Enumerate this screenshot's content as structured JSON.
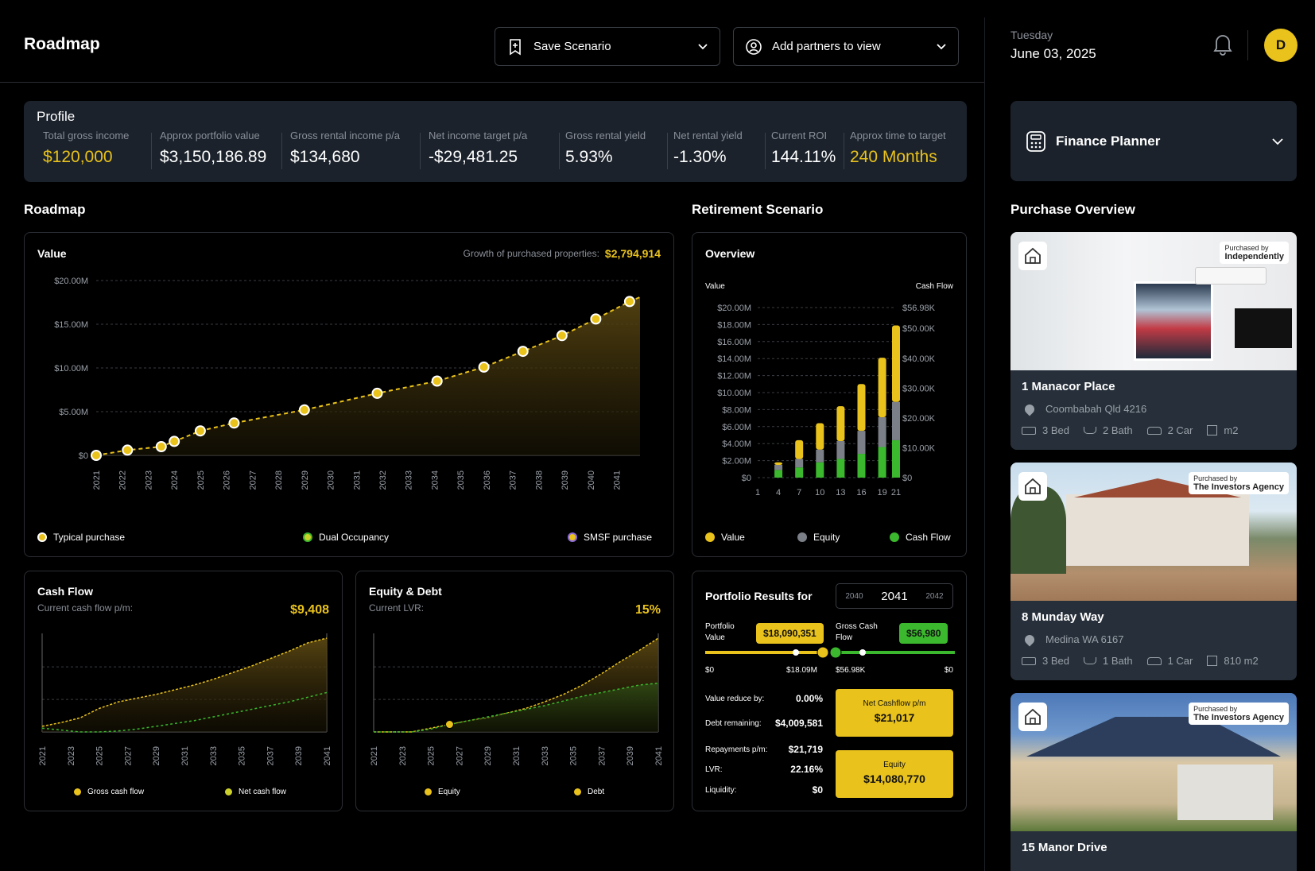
{
  "header": {
    "title": "Roadmap",
    "save_scenario": "Save Scenario",
    "add_partners": "Add partners to view",
    "day": "Tuesday",
    "date": "June 03, 2025",
    "avatar_initial": "D"
  },
  "profile": {
    "title": "Profile",
    "stats": [
      {
        "label": "Total gross income",
        "value": "$120,000"
      },
      {
        "label": "Approx portfolio value",
        "value": "$3,150,186.89"
      },
      {
        "label": "Gross rental income p/a",
        "value": "$134,680"
      },
      {
        "label": "Net income target p/a",
        "value": "-$29,481.25"
      },
      {
        "label": "Gross rental yield",
        "value": "5.93%"
      },
      {
        "label": "Net rental yield",
        "value": "-1.30%"
      },
      {
        "label": "Current ROI",
        "value": "144.11%"
      },
      {
        "label": "Approx time to target",
        "value": "240 Months"
      }
    ]
  },
  "sections": {
    "roadmap": "Roadmap",
    "retirement": "Retirement Scenario",
    "purchase_overview": "Purchase Overview"
  },
  "value_card": {
    "title": "Value",
    "growth_label": "Growth of purchased properties:",
    "growth_value": "$2,794,914",
    "legend": [
      "Typical purchase",
      "Dual Occupancy",
      "SMSF purchase"
    ]
  },
  "overview_card": {
    "title": "Overview",
    "left_axis_label": "Value",
    "right_axis_label": "Cash Flow",
    "legend": [
      "Value",
      "Equity",
      "Cash Flow"
    ]
  },
  "cashflow_card": {
    "title": "Cash Flow",
    "subtitle": "Current cash flow p/m:",
    "value": "$9,408",
    "legend": [
      "Gross cash flow",
      "Net cash flow"
    ]
  },
  "equity_card": {
    "title": "Equity & Debt",
    "subtitle": "Current LVR:",
    "value": "15%",
    "legend": [
      "Equity",
      "Debt"
    ]
  },
  "portfolio": {
    "title": "Portfolio Results for",
    "year_prev": "2040",
    "year_current": "2041",
    "year_next": "2042",
    "portfolio_value_label": "Portfolio Value",
    "portfolio_value": "$18,090,351",
    "gross_cash_label": "Gross Cash Flow",
    "gross_cash": "$56,980",
    "slider_left_min": "$0",
    "slider_left_mark": "$18.09M",
    "slider_right_mark": "$56.98K",
    "slider_right_min": "$0",
    "value_reduce_label": "Value reduce by:",
    "value_reduce": "0.00%",
    "debt_label": "Debt remaining:",
    "debt": "$4,009,581",
    "repay_label": "Repayments p/m:",
    "repay": "$21,719",
    "lvr_label": "LVR:",
    "lvr": "22.16%",
    "liquidity_label": "Liquidity:",
    "liquidity": "$0",
    "net_cashflow_label": "Net Cashflow p/m",
    "net_cashflow": "$21,017",
    "equity_label": "Equity",
    "equity": "$14,080,770"
  },
  "finance_planner": {
    "label": "Finance Planner"
  },
  "properties": [
    {
      "name": "1 Manacor Place",
      "address": "Coombabah Qld 4216",
      "bed": "3 Bed",
      "bath": "2 Bath",
      "car": "2 Car",
      "area": "m2",
      "purchased_by_label": "Purchased by",
      "purchased_by": "Independently"
    },
    {
      "name": "8 Munday Way",
      "address": "Medina WA 6167",
      "bed": "3 Bed",
      "bath": "1 Bath",
      "car": "1 Car",
      "area": "810 m2",
      "purchased_by_label": "Purchased by",
      "purchased_by": "The Investors Agency"
    },
    {
      "name": "15 Manor Drive",
      "address": "",
      "purchased_by_label": "Purchased by",
      "purchased_by": "The Investors Agency"
    }
  ],
  "colors": {
    "accent": "#e9c21c",
    "green": "#3bb82d",
    "gray": "#7b8088",
    "navy": "#1b222b"
  },
  "chart_data": [
    {
      "type": "line",
      "title": "Value",
      "x": [
        "2021",
        "2022",
        "2023",
        "2024",
        "2025",
        "2026",
        "2027",
        "2028",
        "2029",
        "2030",
        "2031",
        "2032",
        "2033",
        "2034",
        "2035",
        "2036",
        "2037",
        "2038",
        "2039",
        "2040",
        "2041"
      ],
      "yticks": [
        "$0",
        "$5.00M",
        "$10.00M",
        "$15.00M",
        "$20.00M"
      ],
      "ylim": [
        0,
        20
      ],
      "points": [
        [
          2021.0,
          0.0
        ],
        [
          2022.2,
          0.6
        ],
        [
          2023.5,
          1.0
        ],
        [
          2024.0,
          1.6
        ],
        [
          2025.0,
          2.8
        ],
        [
          2026.3,
          3.7
        ],
        [
          2029.0,
          5.2
        ],
        [
          2031.8,
          7.1
        ],
        [
          2034.1,
          8.5
        ],
        [
          2035.9,
          10.1
        ],
        [
          2037.4,
          11.9
        ],
        [
          2038.9,
          13.7
        ],
        [
          2040.2,
          15.6
        ],
        [
          2041.5,
          17.6
        ],
        [
          2041.9,
          18.1
        ]
      ],
      "markers": [
        [
          2021.0,
          0.0
        ],
        [
          2022.2,
          0.6
        ],
        [
          2023.5,
          1.0
        ],
        [
          2024.0,
          1.6
        ],
        [
          2025.0,
          2.8
        ],
        [
          2026.3,
          3.7
        ],
        [
          2029.0,
          5.2
        ],
        [
          2031.8,
          7.1
        ],
        [
          2034.1,
          8.5
        ],
        [
          2035.9,
          10.1
        ],
        [
          2037.4,
          11.9
        ],
        [
          2038.9,
          13.7
        ],
        [
          2040.2,
          15.6
        ],
        [
          2041.5,
          17.6
        ]
      ],
      "legend": [
        "Typical purchase",
        "Dual Occupancy",
        "SMSF purchase"
      ]
    },
    {
      "type": "bar",
      "title": "Overview",
      "categories": [
        "1",
        "2",
        "3",
        "4",
        "5",
        "6",
        "7",
        "8",
        "9",
        "10",
        "11",
        "12",
        "13",
        "14",
        "15",
        "16",
        "17",
        "18",
        "19",
        "20",
        "21"
      ],
      "xticks": [
        "1",
        "4",
        "7",
        "10",
        "13",
        "16",
        "19",
        "21"
      ],
      "yticks": [
        "$0",
        "$2.00M",
        "$4.00M",
        "$6.00M",
        "$8.00M",
        "$10.00M",
        "$12.00M",
        "$14.00M",
        "$16.00M",
        "$18.00M",
        "$20.00M"
      ],
      "y2ticks": [
        "$0",
        "$10.00K",
        "$20.00K",
        "$30.00K",
        "$40.00K",
        "$50.00K",
        "$56.98K"
      ],
      "ylim": [
        0,
        20
      ],
      "series": [
        {
          "name": "Cash Flow",
          "values": [
            0,
            0,
            0,
            0.9,
            0,
            0,
            1.2,
            0,
            0,
            1.8,
            0,
            0,
            2.2,
            0,
            0,
            2.8,
            0,
            0,
            3.6,
            0,
            4.4
          ]
        },
        {
          "name": "Equity",
          "values": [
            0,
            0,
            0,
            0.6,
            0,
            0,
            1.0,
            0,
            0,
            1.5,
            0,
            0,
            2.1,
            0,
            0,
            2.7,
            0,
            0,
            3.5,
            0,
            4.5
          ]
        },
        {
          "name": "Value",
          "values": [
            0,
            0,
            0,
            0.3,
            0,
            0,
            2.2,
            0,
            0,
            3.1,
            0,
            0,
            4.1,
            0,
            0,
            5.5,
            0,
            0,
            7.0,
            0,
            9.0
          ]
        }
      ],
      "bars_at": [
        4,
        7,
        10,
        13,
        16,
        19,
        21
      ]
    },
    {
      "type": "area",
      "title": "Cash Flow",
      "xticks": [
        "2021",
        "2023",
        "2025",
        "2027",
        "2029",
        "2031",
        "2033",
        "2035",
        "2037",
        "2039",
        "2041"
      ],
      "series": [
        {
          "name": "Gross cash flow",
          "values": [
            0.06,
            0.1,
            0.15,
            0.25,
            0.32,
            0.36,
            0.4,
            0.45,
            0.5,
            0.56,
            0.63,
            0.7,
            0.78,
            0.86,
            0.95,
            1.0
          ]
        },
        {
          "name": "Net cash flow",
          "values": [
            0.04,
            0.02,
            0.0,
            0.0,
            0.01,
            0.03,
            0.06,
            0.09,
            0.12,
            0.16,
            0.2,
            0.24,
            0.28,
            0.32,
            0.37,
            0.42
          ]
        }
      ]
    },
    {
      "type": "area",
      "title": "Equity & Debt",
      "xticks": [
        "2021",
        "2023",
        "2025",
        "2027",
        "2029",
        "2031",
        "2033",
        "2035",
        "2037",
        "2039",
        "2041"
      ],
      "series": [
        {
          "name": "Equity",
          "values": [
            0,
            0,
            0,
            0.03,
            0.08,
            0.12,
            0.16,
            0.2,
            0.24,
            0.28,
            0.33,
            0.38,
            0.42,
            0.46,
            0.5,
            0.52
          ]
        },
        {
          "name": "Debt",
          "values": [
            0,
            0,
            0,
            0.04,
            0.08,
            0.12,
            0.15,
            0.2,
            0.25,
            0.32,
            0.4,
            0.5,
            0.62,
            0.75,
            0.87,
            1.0
          ]
        }
      ]
    }
  ]
}
